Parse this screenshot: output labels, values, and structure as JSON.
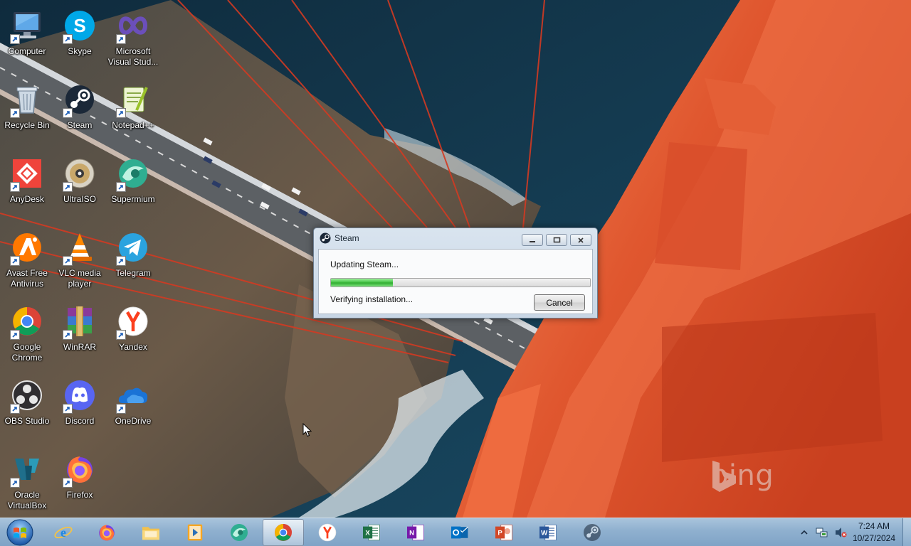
{
  "desktop": {
    "icons": [
      {
        "label": "Computer",
        "icon": "computer-icon",
        "col": 0,
        "row": 0
      },
      {
        "label": "Skype",
        "icon": "skype-icon",
        "col": 1,
        "row": 0
      },
      {
        "label": "Microsoft Visual Stud...",
        "icon": "visual-studio-icon",
        "col": 2,
        "row": 0
      },
      {
        "label": "Recycle Bin",
        "icon": "recycle-bin-icon",
        "col": 0,
        "row": 1
      },
      {
        "label": "Steam",
        "icon": "steam-icon",
        "col": 1,
        "row": 1
      },
      {
        "label": "Notepad++",
        "icon": "notepad-plus-plus-icon",
        "col": 2,
        "row": 1
      },
      {
        "label": "AnyDesk",
        "icon": "anydesk-icon",
        "col": 0,
        "row": 2
      },
      {
        "label": "UltraISO",
        "icon": "ultraiso-icon",
        "col": 1,
        "row": 2
      },
      {
        "label": "Supermium",
        "icon": "supermium-icon",
        "col": 2,
        "row": 2
      },
      {
        "label": "Avast Free Antivirus",
        "icon": "avast-icon",
        "col": 0,
        "row": 3
      },
      {
        "label": "VLC media player",
        "icon": "vlc-icon",
        "col": 1,
        "row": 3
      },
      {
        "label": "Telegram",
        "icon": "telegram-icon",
        "col": 2,
        "row": 3
      },
      {
        "label": "Google Chrome",
        "icon": "chrome-icon",
        "col": 0,
        "row": 4
      },
      {
        "label": "WinRAR",
        "icon": "winrar-icon",
        "col": 1,
        "row": 4
      },
      {
        "label": "Yandex",
        "icon": "yandex-icon",
        "col": 2,
        "row": 4
      },
      {
        "label": "OBS Studio",
        "icon": "obs-icon",
        "col": 0,
        "row": 5
      },
      {
        "label": "Discord",
        "icon": "discord-icon",
        "col": 1,
        "row": 5
      },
      {
        "label": "OneDrive",
        "icon": "onedrive-icon",
        "col": 2,
        "row": 5
      },
      {
        "label": "Oracle VirtualBox",
        "icon": "virtualbox-icon",
        "col": 0,
        "row": 6
      },
      {
        "label": "Firefox",
        "icon": "firefox-icon",
        "col": 1,
        "row": 6
      }
    ],
    "watermark": "bing"
  },
  "steam_dialog": {
    "title": "Steam",
    "status": "Updating Steam...",
    "substatus": "Verifying installation...",
    "progress_percent": 24,
    "cancel_label": "Cancel",
    "controls": [
      "minimize-icon",
      "maximize-icon",
      "close-icon"
    ]
  },
  "taskbar": {
    "start": "windows-logo-icon",
    "items": [
      {
        "name": "internet-explorer",
        "icon": "internet-explorer-icon",
        "active": false
      },
      {
        "name": "firefox",
        "icon": "firefox-icon",
        "active": false
      },
      {
        "name": "file-explorer",
        "icon": "folder-icon",
        "active": false
      },
      {
        "name": "media-player",
        "icon": "media-player-icon",
        "active": false
      },
      {
        "name": "supermium",
        "icon": "supermium-icon",
        "active": false
      },
      {
        "name": "chrome",
        "icon": "chrome-icon",
        "active": true
      },
      {
        "name": "yandex",
        "icon": "yandex-icon",
        "active": false
      },
      {
        "name": "excel",
        "icon": "excel-icon",
        "active": false
      },
      {
        "name": "onenote",
        "icon": "onenote-icon",
        "active": false
      },
      {
        "name": "outlook",
        "icon": "outlook-icon",
        "active": false
      },
      {
        "name": "powerpoint",
        "icon": "powerpoint-icon",
        "active": false
      },
      {
        "name": "word",
        "icon": "word-icon",
        "active": false
      },
      {
        "name": "steam",
        "icon": "steam-icon",
        "active": false
      }
    ],
    "tray": [
      "show-hidden-icons-chevron",
      "network-icon",
      "volume-muted-icon"
    ],
    "time": "7:24 AM",
    "date": "10/27/2024"
  },
  "colors": {
    "progress_green": "#3fbf3f",
    "taskbar_blue": "#8fb0cf",
    "bridge_orange": "#e8633c",
    "sea_blue": "#143b52"
  }
}
